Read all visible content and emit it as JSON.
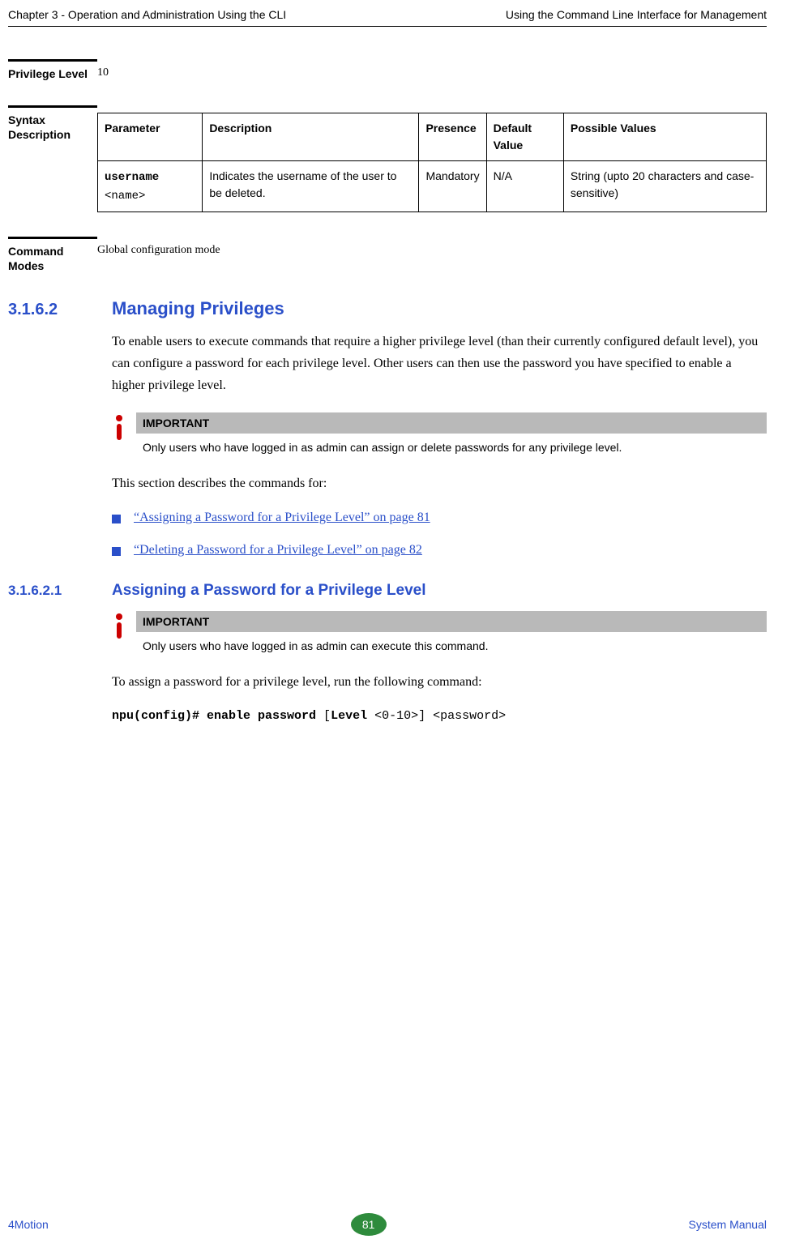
{
  "header": {
    "left": "Chapter 3 - Operation and Administration Using the CLI",
    "right": "Using the Command Line Interface for Management"
  },
  "privilege": {
    "label": "Privilege Level",
    "value": "10"
  },
  "syntax": {
    "label": "Syntax Description",
    "headers": {
      "param": "Parameter",
      "desc": "Description",
      "presence": "Presence",
      "default": "Default Value",
      "possible": "Possible Values"
    },
    "row": {
      "param_bold": "username",
      "param_rest": " <name>",
      "desc": "Indicates the username of the user to be deleted.",
      "presence": "Mandatory",
      "default": "N/A",
      "possible": "String (upto 20 characters and case-sensitive)"
    }
  },
  "command_modes": {
    "label": "Command Modes",
    "value": "Global configuration mode"
  },
  "sec_3_1_6_2": {
    "num": "3.1.6.2",
    "title": "Managing Privileges",
    "para": "To enable users to execute commands that require a higher privilege level (than their currently configured default level), you can configure a password for each privilege level. Other users can then use the password you have specified to enable a higher privilege level.",
    "important_head": "IMPORTANT",
    "important_text": "Only users who have logged in as admin can assign or delete passwords for any privilege level.",
    "intro": "This section describes the commands for:",
    "bullets": [
      "“Assigning a Password for a Privilege Level” on page 81",
      "“Deleting a Password for a Privilege Level” on page 82"
    ]
  },
  "sec_3_1_6_2_1": {
    "num": "3.1.6.2.1",
    "title": "Assigning a Password for a Privilege Level",
    "important_head": "IMPORTANT",
    "important_text": "Only users who have logged in as admin can execute this command.",
    "para": "To assign a password for a privilege level, run the following command:",
    "cmd_b1": "npu(config)# enable password ",
    "cmd_p1": " [",
    "cmd_b2": "Level",
    "cmd_p2": " <0-10>] <password>"
  },
  "footer": {
    "left": "4Motion",
    "page": "81",
    "right": "System Manual"
  }
}
